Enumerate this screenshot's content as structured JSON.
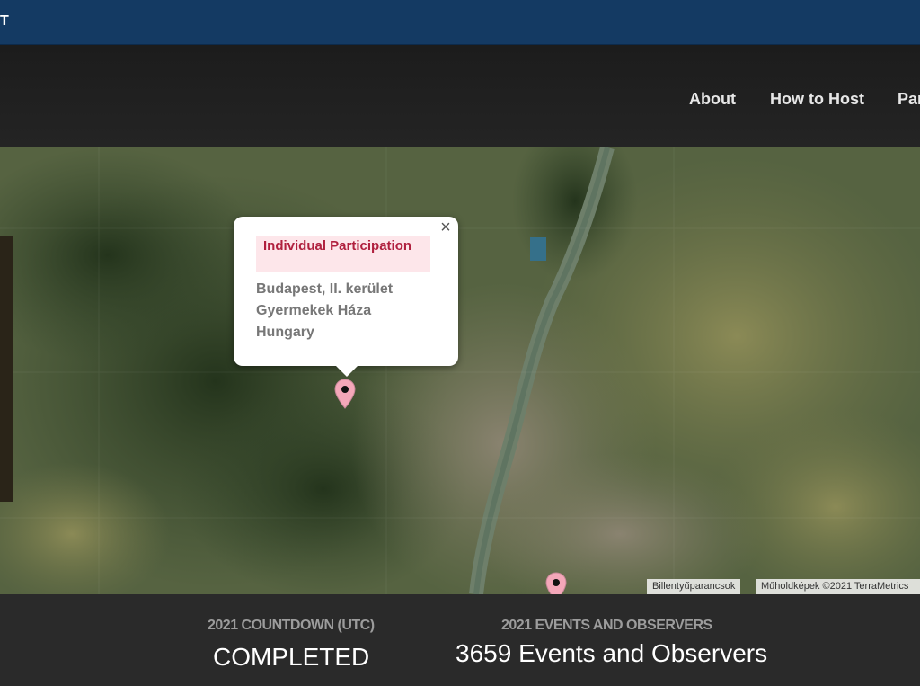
{
  "topbar": {
    "brand": "T"
  },
  "nav": {
    "items": [
      "About",
      "How to Host",
      "Par"
    ]
  },
  "popup": {
    "close": "×",
    "badge": "Individual Participation",
    "lines": [
      "Budapest, II. kerület",
      "Gyermekek Háza",
      "Hungary"
    ]
  },
  "map": {
    "attribution_keys": "Billentyűparancsok",
    "attribution_imagery": "Műholdképek ©2021 TerraMetrics"
  },
  "footer": {
    "countdown_label": "2021 COUNTDOWN (UTC)",
    "countdown_value": "COMPLETED",
    "events_label": "2021 EVENTS AND OBSERVERS",
    "events_value": "3659 Events and Observers"
  },
  "colors": {
    "topbar": "#143a63",
    "badge_text": "#b0203e",
    "badge_bg": "#fde6ea",
    "pin": "#f4a7b9"
  }
}
